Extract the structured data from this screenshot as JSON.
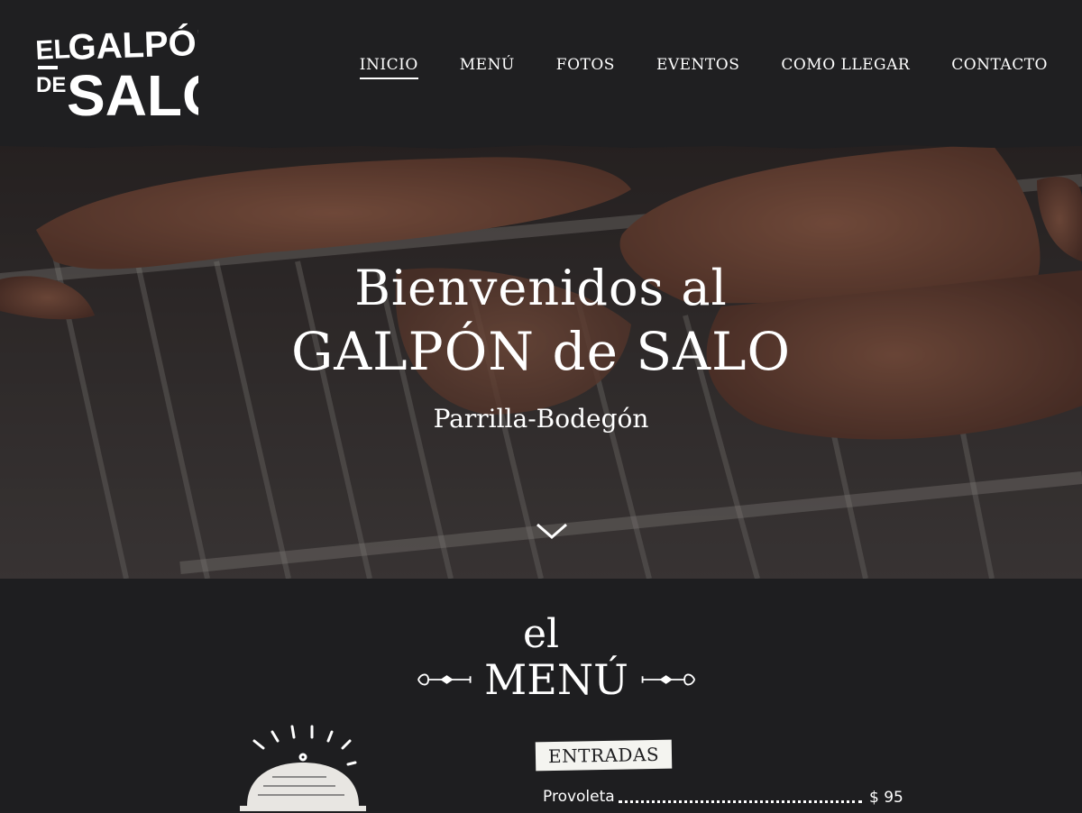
{
  "logo": {
    "line1": "EL GALPÓN",
    "line2_small": "DE",
    "line2_big": "SALO"
  },
  "nav": {
    "items": [
      {
        "label": "INICIO",
        "active": true
      },
      {
        "label": "MENÚ",
        "active": false
      },
      {
        "label": "FOTOS",
        "active": false
      },
      {
        "label": "EVENTOS",
        "active": false
      },
      {
        "label": "COMO LLEGAR",
        "active": false
      },
      {
        "label": "CONTACTO",
        "active": false
      }
    ]
  },
  "hero": {
    "title_line1": "Bienvenidos al",
    "title_line2": "GALPÓN de SALO",
    "subtitle": "Parrilla-Bodegón",
    "scroll_icon": "chevron-down-icon"
  },
  "menu_section": {
    "prefix": "el",
    "title": "MENÚ",
    "illustration": "cloche-icon",
    "category": "ENTRADAS",
    "items": [
      {
        "name": "Provoleta",
        "price": "$ 95"
      }
    ]
  },
  "colors": {
    "background": "#1f1f21",
    "text": "#ffffff",
    "tag_background": "#f4f4f0"
  }
}
